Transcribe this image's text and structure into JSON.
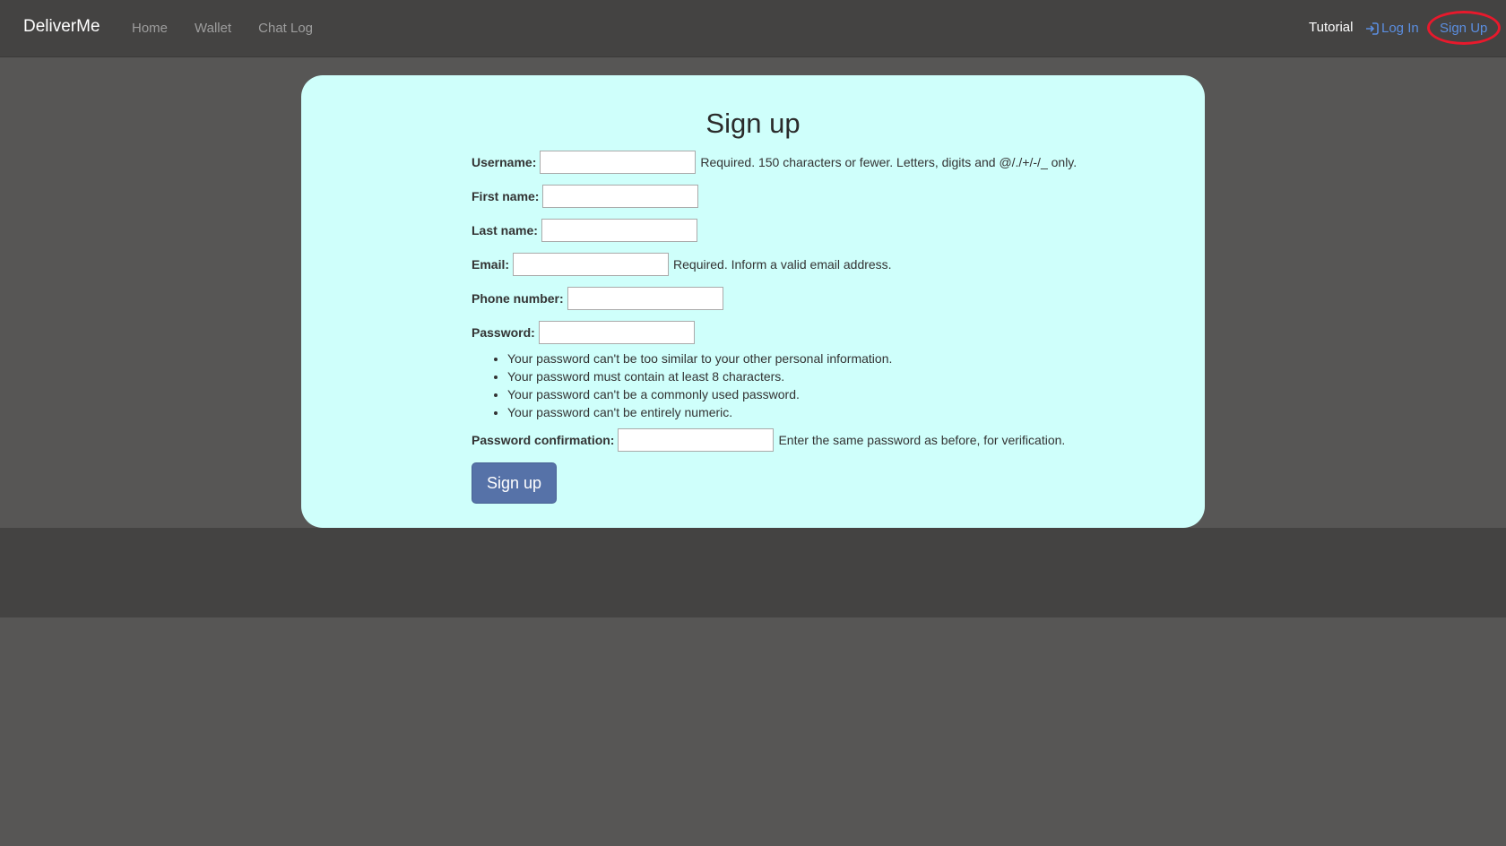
{
  "navbar": {
    "brand": "DeliverMe",
    "left_links": [
      "Home",
      "Wallet",
      "Chat Log"
    ],
    "tutorial": "Tutorial",
    "login": "Log In",
    "signup": "Sign Up"
  },
  "form": {
    "title": "Sign up",
    "fields": {
      "username": {
        "label": "Username:",
        "value": "",
        "help": "Required. 150 characters or fewer. Letters, digits and @/./+/-/_ only."
      },
      "first_name": {
        "label": "First name:",
        "value": ""
      },
      "last_name": {
        "label": "Last name:",
        "value": ""
      },
      "email": {
        "label": "Email:",
        "value": "",
        "help": "Required. Inform a valid email address."
      },
      "phone": {
        "label": "Phone number:",
        "value": ""
      },
      "password": {
        "label": "Password:",
        "value": ""
      },
      "password_help": [
        "Your password can't be too similar to your other personal information.",
        "Your password must contain at least 8 characters.",
        "Your password can't be a commonly used password.",
        "Your password can't be entirely numeric."
      ],
      "password_confirmation": {
        "label": "Password confirmation:",
        "value": "",
        "help": "Enter the same password as before, for verification."
      }
    },
    "submit_label": "Sign up"
  },
  "colors": {
    "accent": "#5b8ee0",
    "card": "#cffffb",
    "highlight": "#e8192c"
  }
}
